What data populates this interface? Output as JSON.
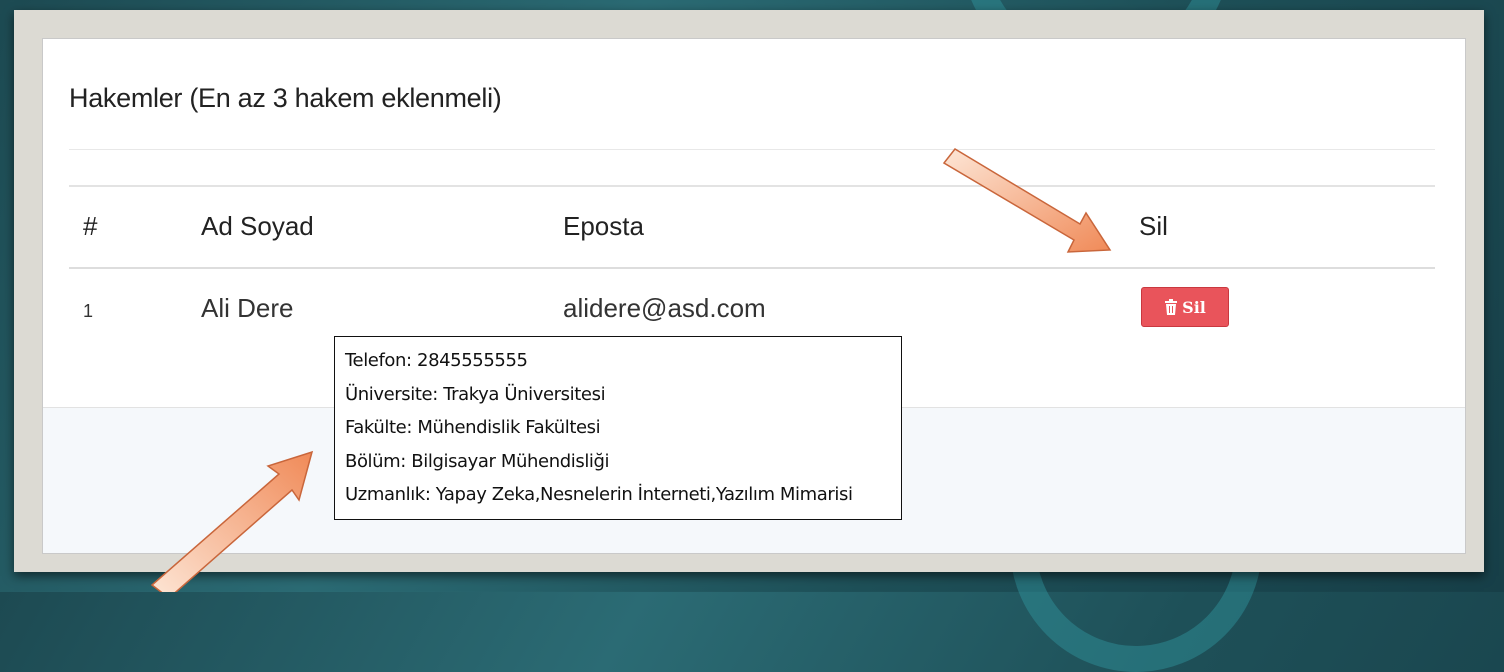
{
  "panel": {
    "title": "Hakemler (En az 3 hakem eklenmeli)"
  },
  "table": {
    "headers": {
      "index": "#",
      "name": "Ad Soyad",
      "email": "Eposta",
      "delete": "Sil"
    },
    "rows": [
      {
        "index": "1",
        "name": "Ali Dere",
        "email": "alidere@asd.com",
        "delete_label": "Sil"
      }
    ]
  },
  "tooltip": {
    "lines": [
      "Telefon: 2845555555",
      "Üniversite: Trakya Üniversitesi",
      "Fakülte: Mühendislik Fakültesi",
      "Bölüm: Bilgisayar Mühendisliği",
      "Uzmanlık: Yapay Zeka,Nesnelerin İnterneti,Yazılım Mimarisi"
    ]
  },
  "colors": {
    "delete_button": "#e9545b",
    "annotation_arrow": "#f39a6e",
    "background": "#1d4a52"
  },
  "icons": {
    "delete": "trash-icon",
    "annotation": "arrow-pointer"
  }
}
